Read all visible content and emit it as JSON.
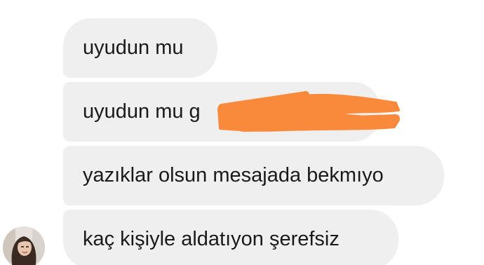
{
  "conversation": {
    "messages": [
      {
        "text": "uyudun mu"
      },
      {
        "text": "uyudun mu g",
        "redacted": true,
        "redaction_color": "#f98a3c"
      },
      {
        "text": "yazıklar olsun mesajada bekmıyo"
      },
      {
        "text": "kaç kişiyle aldatıyon şerefsiz"
      }
    ],
    "bubble_color": "#efefef",
    "text_color": "#1a1a1a"
  },
  "sender": {
    "avatar_icon": "profile-photo"
  }
}
